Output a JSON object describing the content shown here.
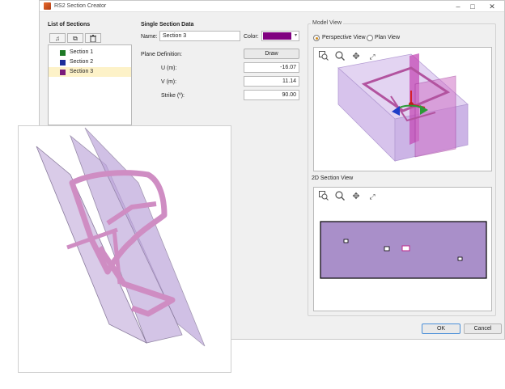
{
  "window": {
    "title": "RS2 Section Creator",
    "minimize": "–",
    "maximize": "□",
    "close": "✕"
  },
  "list": {
    "title": "List of Sections",
    "tools": {
      "add": "♫",
      "copy": "⧉",
      "delete": "Ὕ1"
    },
    "items": [
      {
        "label": "Section 1",
        "color": "#1f7a26"
      },
      {
        "label": "Section 2",
        "color": "#1d2e9a"
      },
      {
        "label": "Section 3",
        "color": "#7b1a7b"
      }
    ]
  },
  "single": {
    "title": "Single Section Data",
    "name_label": "Name:",
    "name_value": "Section 3",
    "color_label": "Color:",
    "color_value": "#800080",
    "plane_label": "Plane Definition:",
    "draw_label": "Draw",
    "u_label": "U (m):",
    "u_value": "-16.07",
    "v_label": "V (m):",
    "v_value": "11.14",
    "strike_label": "Strike (º):",
    "strike_value": "90.00"
  },
  "model": {
    "title": "Model View",
    "perspective_label": "Perspective View",
    "plan_label": "Plan View",
    "section_title": "2D Section View"
  },
  "footer": {
    "ok_label": "OK",
    "cancel_label": "Cancel"
  },
  "colors": {
    "section_fill": "#a98fc9",
    "accent": "#d08a1a"
  }
}
